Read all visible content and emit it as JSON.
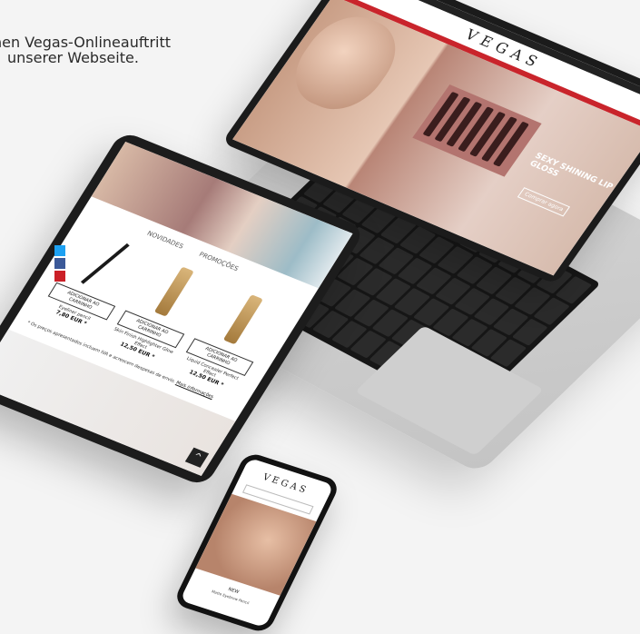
{
  "caption": {
    "line1": "hen Vegas-Onlineauftritt",
    "line2": "unserer Webseite."
  },
  "laptop": {
    "logo": "VEGAS",
    "hero_title": "SEXY SHINING LIP GLOSS",
    "hero_cta": "Comprar agora"
  },
  "tablet": {
    "tabs": [
      "NOVIDADES",
      "PROMOÇÕES"
    ],
    "products": [
      {
        "button": "ADICIONAR AO CARRINHO",
        "name": "Eyeliner pencil",
        "price": "7,80 EUR *"
      },
      {
        "button": "ADICIONAR AO CARRINHO",
        "name": "Skin Finish Highlighter Glow Effect",
        "price": "12,50 EUR *"
      },
      {
        "button": "ADICIONAR AO CARRINHO",
        "name": "Liquid Concealer Perfect Effect",
        "price": "12,50 EUR *"
      }
    ],
    "note": "* Os preços apresentados incluem IVA e acrescem despesas de envio.",
    "more": "Mais informações",
    "scroll_icon": "^"
  },
  "phone": {
    "logo": "VEGAS",
    "new_label": "NEW",
    "product_name": "Matte Eyebrow Pencil"
  },
  "colors": {
    "accent_red": "#c9242b",
    "facebook": "#3b5998",
    "twitter": "#1da1f2",
    "pinterest": "#cb2027"
  }
}
